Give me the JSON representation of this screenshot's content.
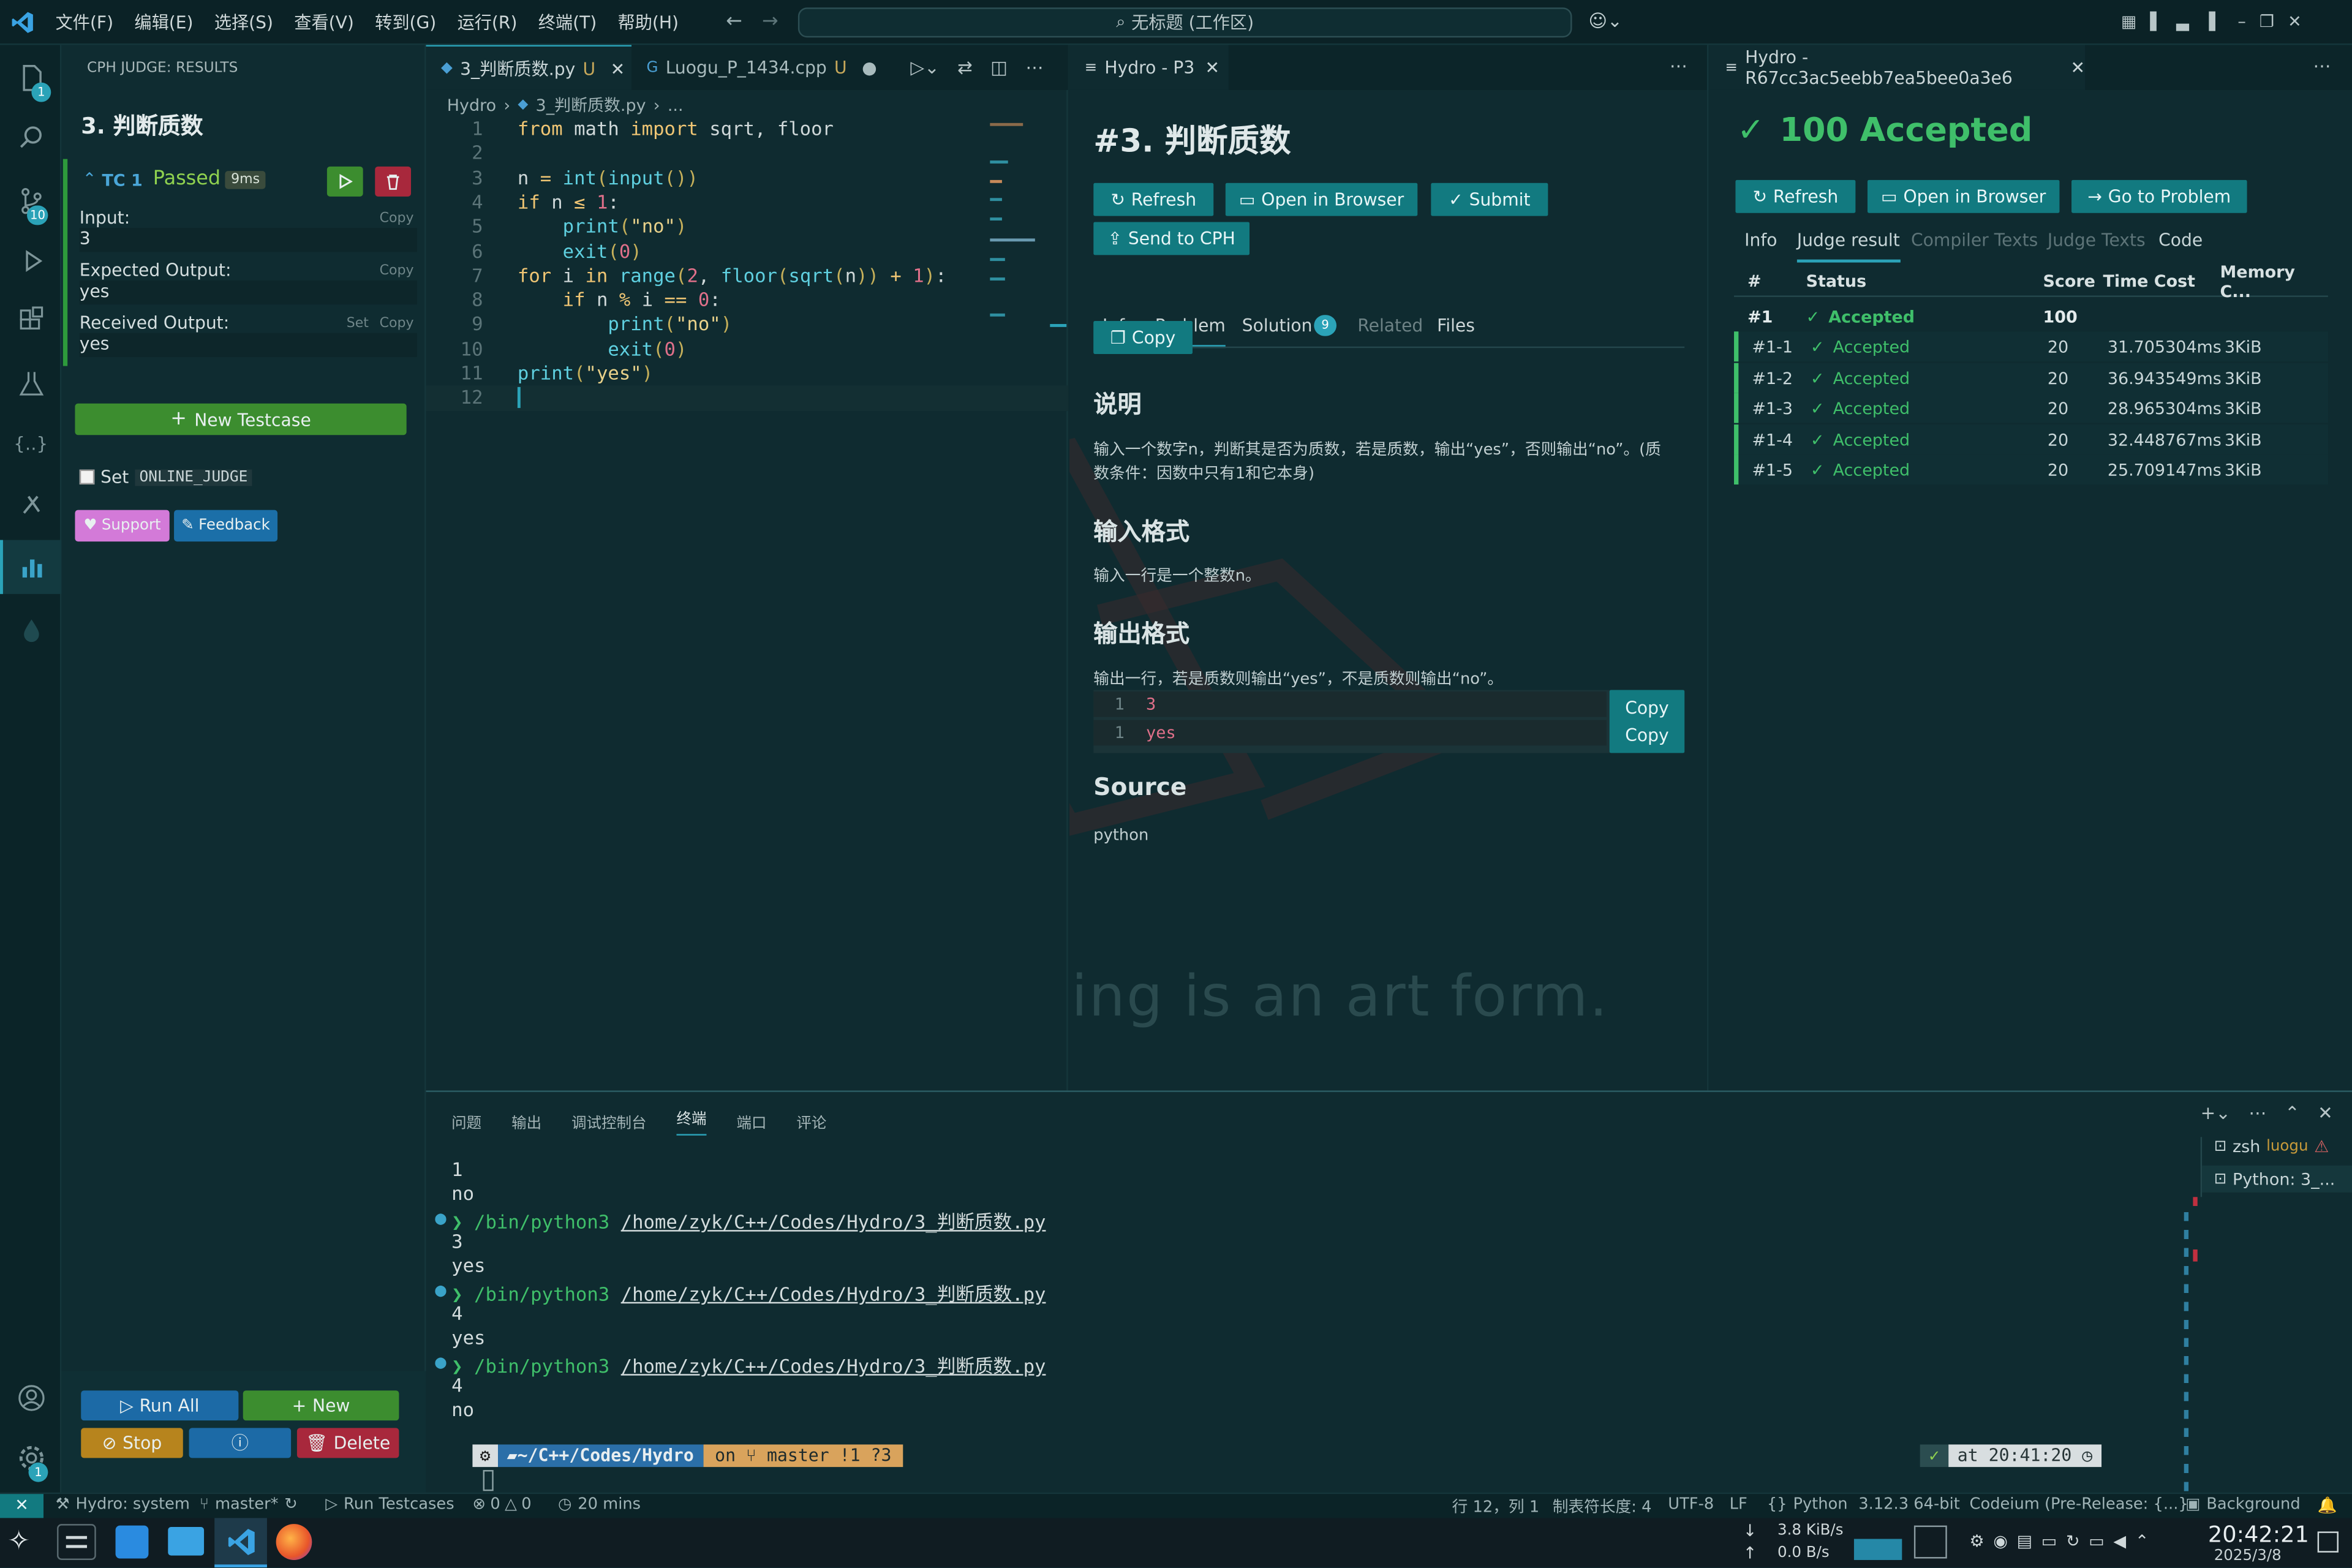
{
  "menubar": {
    "items": [
      "文件(F)",
      "编辑(E)",
      "选择(S)",
      "查看(V)",
      "转到(G)",
      "运行(R)",
      "终端(T)",
      "帮助(H)"
    ],
    "search_text": "无标题 (工作区)"
  },
  "activity_bar": {
    "explorer_badge": "1",
    "scm_badge": "10",
    "settings_badge": "1"
  },
  "cph": {
    "header": "CPH JUDGE: RESULTS",
    "problem_title": "3. 判断质数",
    "testcase": {
      "name": "TC 1",
      "status": "Passed",
      "time": "9ms",
      "input_label": "Input:",
      "input_value": "3",
      "expected_label": "Expected Output:",
      "expected_value": "yes",
      "received_label": "Received Output:",
      "received_value": "yes",
      "copy": "Copy",
      "set": "Set"
    },
    "new_testcase": "New Testcase",
    "set_label": "Set",
    "online_judge": "ONLINE_JUDGE",
    "support": "Support",
    "feedback": "Feedback",
    "run_all": "Run All",
    "new": "New",
    "stop": "Stop",
    "delete": "Delete"
  },
  "editor": {
    "tab1": "3_判断质数.py",
    "tab1_status": "U",
    "tab2": "Luogu_P_1434.cpp",
    "tab2_status": "U",
    "breadcrumb_root": "Hydro",
    "breadcrumb_file": "3_判断质数.py",
    "breadcrumb_more": "...",
    "line_numbers": [
      "1",
      "2",
      "3",
      "4",
      "5",
      "6",
      "7",
      "8",
      "9",
      "10",
      "11",
      "12"
    ]
  },
  "problem": {
    "tab_title": "Hydro - P3",
    "title": "#3. 判断质数",
    "refresh": "Refresh",
    "open_browser": "Open in Browser",
    "submit": "Submit",
    "send_cph": "Send to CPH",
    "tabs": {
      "info": "Info",
      "problem": "Problem",
      "solution": "Solution",
      "solution_count": "9",
      "related": "Related",
      "files": "Files"
    },
    "copy": "Copy",
    "desc_title": "说明",
    "desc_text_1": "输入一个数字n，判断其是否为质数，若是质数，输出“yes”，否则输出“no”。(质",
    "desc_text_2": "数条件：因数中只有1和它本身)",
    "input_title": "输入格式",
    "input_text": "输入一行是一个整数n。",
    "output_title": "输出格式",
    "output_text": "输出一行，若是质数则输出“yes”，不是质数则输出“no”。",
    "sample_in_ln": "1",
    "sample_in": "3",
    "sample_out_ln": "1",
    "sample_out": "yes",
    "source_title": "Source",
    "source_text": "python",
    "watermark": "Programming is an art form."
  },
  "judge": {
    "tab_title": "Hydro - R67cc3ac5eebb7ea5bee0a3e6",
    "result": "100 Accepted",
    "refresh": "Refresh",
    "open_browser": "Open in Browser",
    "go_problem": "Go to Problem",
    "tabs": [
      "Info",
      "Judge result",
      "Compiler Texts",
      "Judge Texts",
      "Code"
    ],
    "headers": {
      "num": "#",
      "status": "Status",
      "score": "Score",
      "time": "Time Cost",
      "memory": "Memory C..."
    },
    "rows": [
      {
        "id": "#1",
        "status": "Accepted",
        "score": "100",
        "time": "",
        "memory": ""
      },
      {
        "id": "#1-1",
        "status": "Accepted",
        "score": "20",
        "time": "31.705304ms",
        "memory": "3KiB"
      },
      {
        "id": "#1-2",
        "status": "Accepted",
        "score": "20",
        "time": "36.943549ms",
        "memory": "3KiB"
      },
      {
        "id": "#1-3",
        "status": "Accepted",
        "score": "20",
        "time": "28.965304ms",
        "memory": "3KiB"
      },
      {
        "id": "#1-4",
        "status": "Accepted",
        "score": "20",
        "time": "32.448767ms",
        "memory": "3KiB"
      },
      {
        "id": "#1-5",
        "status": "Accepted",
        "score": "20",
        "time": "25.709147ms",
        "memory": "3KiB"
      }
    ]
  },
  "terminal": {
    "tabs": [
      "问题",
      "输出",
      "调试控制台",
      "终端",
      "端口",
      "评论"
    ],
    "lines": {
      "l1": "1",
      "l2": "no",
      "cmd": "/bin/python3",
      "path": "/home/zyk/C++/Codes/Hydro/3_判断质数.py",
      "l4": "3",
      "l5": "yes",
      "l7": "4",
      "l8": "yes",
      "l10": "4",
      "l11": "no"
    },
    "prompt_dir": "~/C++/Codes/Hydro",
    "prompt_git": "on",
    "prompt_branch": "master !1 ?3",
    "prompt_time": "at 20:41:20",
    "shell1": "zsh",
    "shell1_sub": "luogu",
    "shell2": "Python: 3_..."
  },
  "status": {
    "hydro": "Hydro: system",
    "branch": "master*",
    "run_testcases": "Run Testcases",
    "errors": "0",
    "warnings": "0",
    "time": "20 mins",
    "position": "行 12，列 1",
    "tab_size": "制表符长度: 4",
    "encoding": "UTF-8",
    "eol": "LF",
    "lang": "Python",
    "py_version": "3.12.3 64-bit",
    "codeium": "Codeium (Pre-Release: {...}",
    "background": "Background"
  },
  "taskbar": {
    "net_down": "3.8 KiB/s",
    "net_up": "0.0 B/s",
    "clock": "20:42:21",
    "date": "2025/3/8"
  },
  "colors": {
    "accent": "#127a80",
    "accepted": "#3fbf6a",
    "run_green": "#3c8d2f",
    "delete_red": "#a8283c",
    "stop_amber": "#b7841d"
  }
}
